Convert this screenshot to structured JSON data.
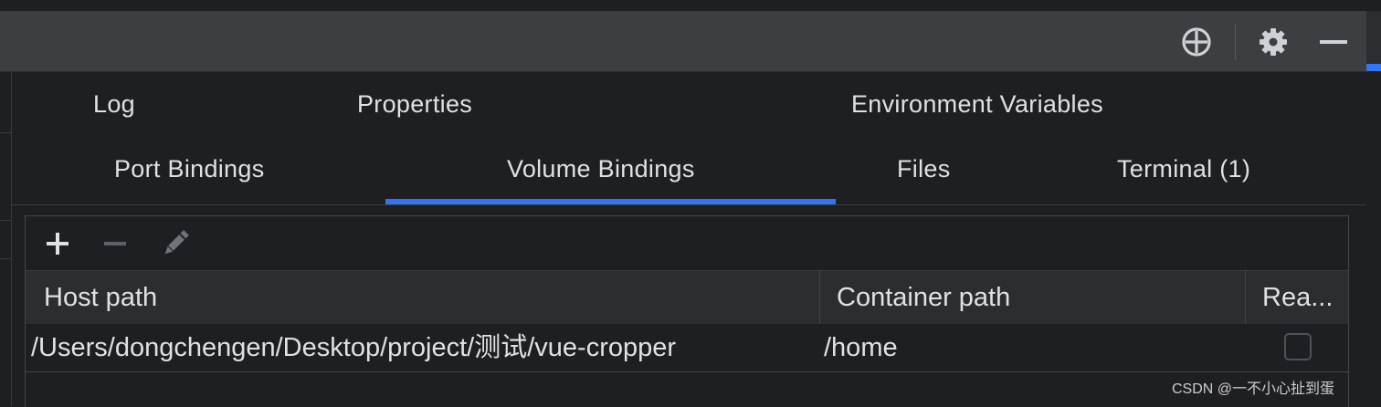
{
  "toolbar": {
    "icons": [
      "crosshair-icon",
      "gear-icon",
      "minimize-icon"
    ]
  },
  "tabs": [
    {
      "label": "Log"
    },
    {
      "label": "Properties"
    },
    {
      "label": "Environment Variables"
    },
    {
      "label": "Port Bindings"
    },
    {
      "label": "Volume Bindings",
      "selected": true
    },
    {
      "label": "Files"
    },
    {
      "label": "Terminal (1)"
    }
  ],
  "actions": {
    "add_icon": "plus-icon",
    "remove_icon": "minus-icon",
    "edit_icon": "pencil-icon"
  },
  "table": {
    "columns": [
      "Host path",
      "Container path",
      "Rea..."
    ],
    "rows": [
      {
        "host_path": "/Users/dongchengen/Desktop/project/测试/vue-cropper",
        "container_path": "/home",
        "read_only": false
      }
    ]
  },
  "watermark": "CSDN @一不小心扯到蛋",
  "colors": {
    "accent": "#3574f0",
    "toolbar": "#3c3f41",
    "background": "#1e1f22"
  }
}
